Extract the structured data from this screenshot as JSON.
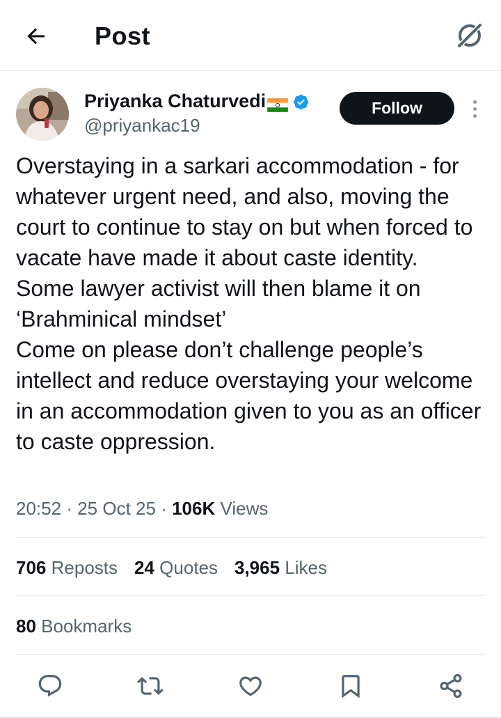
{
  "header": {
    "title": "Post",
    "back_icon": "arrow-left-icon",
    "grok_icon": "grok-icon"
  },
  "author": {
    "name": "Priyanka Chaturvedi",
    "flag_icon": "india-flag-icon",
    "verified_icon": "verified-badge-icon",
    "handle": "@priyankac19",
    "follow_label": "Follow"
  },
  "post": {
    "text": "Overstaying in a sarkari accommodation - for whatever urgent need, and also, moving the court to continue to stay on but when forced  to vacate have made it about caste identity.\nSome lawyer activist will then blame it on ‘Brahminical mindset’\nCome on please don’t challenge people’s intellect and reduce overstaying your welcome in an accommodation given to you as an officer to caste oppression.",
    "time": "20:52",
    "sep1": "·",
    "date": "25 Oct 25",
    "sep2": "·",
    "views_count": "106K",
    "views_label": "Views"
  },
  "stats": {
    "reposts_count": "706",
    "reposts_label": "Reposts",
    "quotes_count": "24",
    "quotes_label": "Quotes",
    "likes_count": "3,965",
    "likes_label": "Likes",
    "bookmarks_count": "80",
    "bookmarks_label": "Bookmarks"
  },
  "colors": {
    "text_primary": "#0f1419",
    "text_secondary": "#536471",
    "verified_blue": "#1d9bf0",
    "divider": "#e6e9ec"
  },
  "actions": [
    "reply-icon",
    "repost-icon",
    "like-icon",
    "bookmark-icon",
    "share-icon"
  ]
}
